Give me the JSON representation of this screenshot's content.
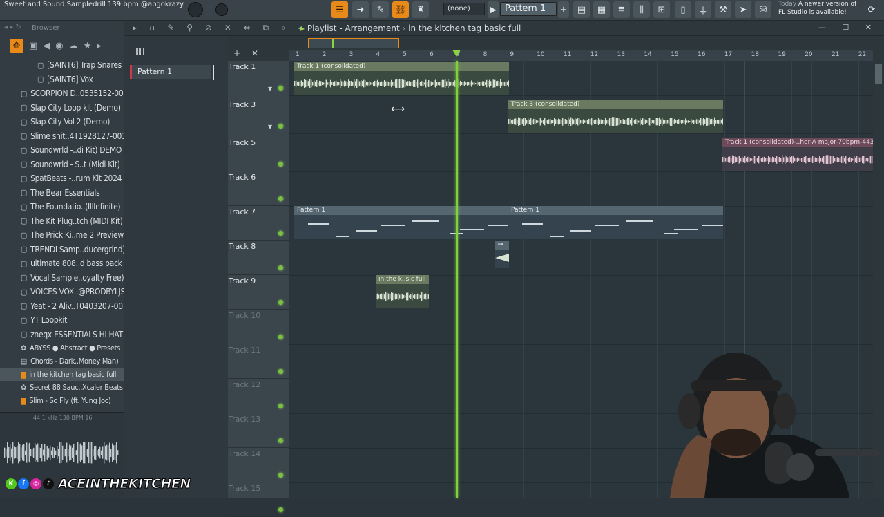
{
  "topbar": {
    "song_title": "Sweet and Sound Sampledrill 139 bpm @apgokrazy.",
    "none_field": "(none)",
    "pattern_selector": "Pattern 1",
    "update_notice_day": "Today",
    "update_notice_text": "A newer version of FL Studio is available!"
  },
  "browser": {
    "header": "Browser",
    "items": [
      {
        "label": "[SAINT6] Trap Snares",
        "sub": true
      },
      {
        "label": "[SAINT6] Vox",
        "sub": true
      },
      {
        "label": "SCORPION D..0535152-001"
      },
      {
        "label": "Slap City Loop kit (Demo)"
      },
      {
        "label": "Slap City Vol 2 (Demo)"
      },
      {
        "label": "Slime shit..4T1928127-001"
      },
      {
        "label": "Soundwrld -..di Kit) DEMO"
      },
      {
        "label": "Soundwrld - S..t (Midi Kit)"
      },
      {
        "label": "SpatBeats -..rum Kit 2024"
      },
      {
        "label": "The Bear Essentials"
      },
      {
        "label": "The Foundatio..(IllInfinite)"
      },
      {
        "label": "The Kit Plug..tch (MIDI Kit)"
      },
      {
        "label": "The Prick Ki..me 2 Preview"
      },
      {
        "label": "TRENDI Samp..ducergrind)"
      },
      {
        "label": "ultimate 808..d bass pack"
      },
      {
        "label": "Vocal Sample..oyalty Free)"
      },
      {
        "label": "VOICES VOX..@PRODBYLJS"
      },
      {
        "label": "Yeat - 2 Aliv..T0403207-001"
      },
      {
        "label": "YT Loopkit"
      },
      {
        "label": "zneqx ESSENTIALS HI HAT"
      }
    ],
    "files": [
      {
        "label": "ABYSS ● Abstract ● Presets",
        "icon": "gear-icon"
      },
      {
        "label": "Chords - Dark..Money Man)",
        "icon": "file-icon"
      },
      {
        "label": "in the kitchen tag basic full",
        "icon": "audio-file-icon",
        "active": true
      },
      {
        "label": "Secret 88 Sauc..Xcaler Beats",
        "icon": "gear-icon"
      },
      {
        "label": "Slim - So Fly (ft. Yung Joc)",
        "icon": "audio-file-icon"
      }
    ],
    "preview_info": "44.1 kHz 130 BPM 16"
  },
  "playlist": {
    "title": "Playlist - Arrangement",
    "arrangement": "in the kitchen tag basic full",
    "pattern_item": "Pattern 1",
    "ruler": [
      "1",
      "2",
      "3",
      "4",
      "5",
      "6",
      "7",
      "8",
      "9",
      "10",
      "11",
      "12",
      "13",
      "14",
      "15",
      "16",
      "17",
      "18",
      "19",
      "20",
      "21",
      "22"
    ],
    "tracks": [
      {
        "name": "Track 1",
        "active": true
      },
      {
        "name": "Track 3",
        "active": true
      },
      {
        "name": "Track 5",
        "active": true
      },
      {
        "name": "Track 6",
        "active": true
      },
      {
        "name": "Track 7",
        "active": true
      },
      {
        "name": "Track 8",
        "active": true
      },
      {
        "name": "Track 9",
        "active": true
      },
      {
        "name": "Track 10",
        "active": false
      },
      {
        "name": "Track 11",
        "active": false
      },
      {
        "name": "Track 12",
        "active": false
      },
      {
        "name": "Track 13",
        "active": false
      },
      {
        "name": "Track 14",
        "active": false
      },
      {
        "name": "Track 15",
        "active": false
      }
    ],
    "clips": {
      "track1": "Track 1 (consolidated)",
      "track3": "Track 3 (consolidated)",
      "track5": "Track 1 (consolidated)-..her-A major-70bpm-443hz",
      "pattern_a": "Pattern 1",
      "pattern_b": "Pattern 1",
      "track9": "in the k..sic full"
    }
  },
  "overlay": {
    "watermark": "ACEINTHEKITCHEN"
  },
  "colors": {
    "accent": "#e88a1a",
    "playhead": "#7fd33a"
  }
}
